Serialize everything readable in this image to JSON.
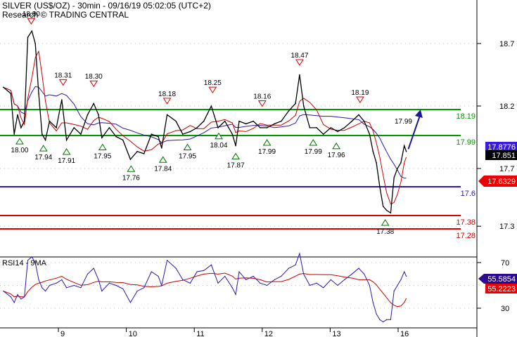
{
  "header": {
    "title": "SILVER (US$/OZ) - 30min - 09/16/19 05:02:05 (UTC+2)",
    "source": "Research © TRADING CENTRAL"
  },
  "rsi_title": "RSI14 - 9MA",
  "colors": {
    "price": "#000000",
    "ma_slow": "#2a1ab0",
    "ma_fast": "#cc0000",
    "resistance": "#009900",
    "pivot": "#2a1ab0",
    "support": "#dd0000",
    "arrow": "#1a1a90"
  },
  "chart_data": [
    {
      "type": "line",
      "title": "SILVER (US$/OZ) - 30min",
      "ylim": [
        17.25,
        18.85
      ],
      "y_ticks": [
        "18.7",
        "18.2",
        "17.7",
        "17.3"
      ],
      "x_ticks": [
        {
          "t": 1,
          "label": "9"
        },
        {
          "t": 2,
          "label": "10"
        },
        {
          "t": 3,
          "label": "11"
        },
        {
          "t": 4,
          "label": "12"
        },
        {
          "t": 5,
          "label": "13"
        },
        {
          "t": 6,
          "label": "16"
        }
      ],
      "x": [
        0.19,
        0.3,
        0.35,
        0.4,
        0.45,
        0.5,
        0.55,
        0.61,
        0.66,
        0.71,
        0.76,
        0.81,
        0.87,
        0.97,
        1.05,
        1.12,
        1.23,
        1.33,
        1.43,
        1.52,
        1.59,
        1.64,
        1.75,
        1.85,
        1.95,
        2.06,
        2.16,
        2.26,
        2.37,
        2.47,
        2.52,
        2.6,
        2.73,
        2.83,
        2.94,
        3.04,
        3.14,
        3.25,
        3.35,
        3.45,
        3.56,
        3.61,
        3.66,
        3.76,
        3.87,
        3.97,
        4.07,
        4.18,
        4.28,
        4.39,
        4.49,
        4.55,
        4.61,
        4.7,
        4.8,
        4.9,
        5.01,
        5.11,
        5.21,
        5.32,
        5.42,
        5.5,
        5.58,
        5.63,
        5.68,
        5.73,
        5.78,
        5.83,
        5.89,
        5.94,
        5.99,
        6.04,
        6.09,
        6.12
      ],
      "close": [
        18.35,
        18.3,
        18.0,
        18.15,
        18.05,
        18.1,
        18.75,
        18.8,
        18.7,
        18.3,
        18.0,
        17.95,
        18.1,
        18.05,
        18.25,
        17.95,
        18.05,
        18.0,
        18.15,
        18.22,
        18.15,
        17.97,
        18.05,
        17.98,
        17.95,
        17.78,
        17.85,
        17.83,
        18.0,
        17.98,
        17.88,
        18.15,
        18.1,
        18.0,
        18.02,
        18.05,
        18.1,
        18.2,
        18.05,
        18.1,
        18.0,
        17.9,
        18.1,
        18.08,
        18.1,
        18.05,
        18.05,
        18.08,
        18.1,
        18.18,
        18.22,
        18.45,
        18.2,
        18.05,
        18.05,
        18.0,
        18.05,
        18.02,
        18.05,
        18.1,
        18.15,
        18.1,
        18.0,
        17.85,
        17.75,
        17.6,
        17.45,
        17.42,
        17.4,
        17.65,
        17.7,
        17.75,
        17.9,
        17.85
      ],
      "levels": [
        {
          "value": 18.19,
          "label": "18.19",
          "kind": "resistance"
        },
        {
          "value": 17.99,
          "label": "17.99",
          "kind": "resistance"
        },
        {
          "value": 17.6,
          "label": "17.6",
          "kind": "pivot"
        },
        {
          "value": 17.38,
          "label": "17.38",
          "kind": "support"
        },
        {
          "value": 17.28,
          "label": "17.28",
          "kind": "support"
        }
      ],
      "highs": [
        {
          "t": 0.6,
          "label": "18.80",
          "v": 18.8
        },
        {
          "t": 1.07,
          "label": "18.31",
          "v": 18.31
        },
        {
          "t": 1.52,
          "label": "18.30",
          "v": 18.3
        },
        {
          "t": 2.6,
          "label": "18.18",
          "v": 18.18
        },
        {
          "t": 3.27,
          "label": "18.25",
          "v": 18.25
        },
        {
          "t": 4.0,
          "label": "18.16",
          "v": 18.16
        },
        {
          "t": 4.55,
          "label": "18.47",
          "v": 18.47
        },
        {
          "t": 5.44,
          "label": "18.19",
          "v": 18.19
        }
      ],
      "lows": [
        {
          "t": 0.43,
          "label": "18.00",
          "v": 18.0
        },
        {
          "t": 0.78,
          "label": "17.94",
          "v": 17.94
        },
        {
          "t": 1.12,
          "label": "17.91",
          "v": 17.91
        },
        {
          "t": 1.65,
          "label": "17.95",
          "v": 17.95
        },
        {
          "t": 2.07,
          "label": "17.76",
          "v": 17.76
        },
        {
          "t": 2.54,
          "label": "17.84",
          "v": 17.84
        },
        {
          "t": 2.9,
          "label": "17.95",
          "v": 17.95
        },
        {
          "t": 3.36,
          "label": "18.04",
          "v": 18.04
        },
        {
          "t": 3.61,
          "label": "17.87",
          "v": 17.87
        },
        {
          "t": 4.07,
          "label": "17.99",
          "v": 17.99
        },
        {
          "t": 4.75,
          "label": "17.99",
          "v": 17.99
        },
        {
          "t": 5.09,
          "label": "17.96",
          "v": 17.96
        },
        {
          "t": 5.81,
          "label": "17.38",
          "v": 17.38
        }
      ],
      "projection": {
        "from": {
          "t": 6.15,
          "v": 17.87
        },
        "to": {
          "t": 6.33,
          "v": 18.19
        },
        "label": "17.99"
      },
      "last_values": [
        {
          "label": "17.8776",
          "color": "#3a1ae0"
        },
        {
          "label": "17.851",
          "color": "#000000"
        },
        {
          "label": "17.6329",
          "color": "#ee0000"
        }
      ]
    },
    {
      "type": "line",
      "title": "RSI14 - 9MA",
      "ylim": [
        15,
        80
      ],
      "y_ticks": [
        "70",
        "30"
      ],
      "rsi": [
        45,
        40,
        35,
        42,
        38,
        40,
        72,
        75,
        70,
        55,
        48,
        45,
        50,
        52,
        55,
        48,
        50,
        48,
        60,
        65,
        55,
        45,
        52,
        50,
        47,
        35,
        45,
        48,
        62,
        58,
        50,
        72,
        65,
        55,
        52,
        62,
        63,
        68,
        52,
        58,
        48,
        42,
        62,
        55,
        58,
        52,
        50,
        55,
        58,
        65,
        68,
        78,
        60,
        50,
        52,
        48,
        55,
        50,
        55,
        60,
        65,
        60,
        50,
        35,
        25,
        20,
        18,
        20,
        20,
        45,
        50,
        55,
        62,
        58
      ],
      "last_values": [
        {
          "label": "55.5854",
          "color": "#2a0a90"
        },
        {
          "label": "55.2223",
          "color": "#ee0000"
        }
      ]
    }
  ]
}
